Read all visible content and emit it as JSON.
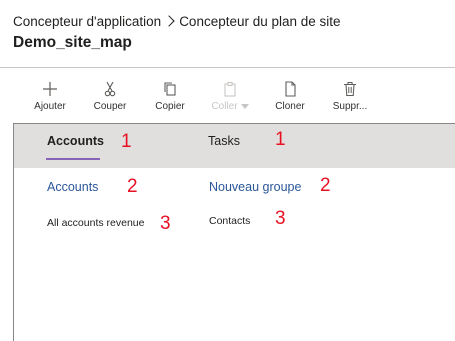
{
  "breadcrumb": {
    "items": [
      "Concepteur d'application",
      "Concepteur du plan de site"
    ]
  },
  "app": {
    "title": "Demo_site_map"
  },
  "toolbar": {
    "items": [
      {
        "label": "Ajouter",
        "icon": "plus-icon",
        "disabled": false
      },
      {
        "label": "Couper",
        "icon": "scissors-icon",
        "disabled": false
      },
      {
        "label": "Copier",
        "icon": "copy-icon",
        "disabled": false
      },
      {
        "label": "Coller",
        "icon": "paste-icon",
        "disabled": true
      },
      {
        "label": "Cloner",
        "icon": "clone-icon",
        "disabled": false
      },
      {
        "label": "Suppr...",
        "icon": "trash-icon",
        "disabled": false
      }
    ]
  },
  "colors": {
    "accent": "#8764b8",
    "link": "#2b579a",
    "annotation": "#e81123",
    "area_bar": "#e1dfdd"
  },
  "areas": [
    {
      "label": "Accounts",
      "marker": "1",
      "active": true
    },
    {
      "label": "Tasks",
      "marker": "1",
      "active": false
    }
  ],
  "groups": [
    {
      "title": "Accounts",
      "marker": "2",
      "subarea": {
        "label": "All accounts revenue",
        "marker": "3"
      }
    },
    {
      "title": "Nouveau groupe",
      "marker": "2",
      "subarea": {
        "label": "Contacts",
        "marker": "3"
      }
    }
  ]
}
